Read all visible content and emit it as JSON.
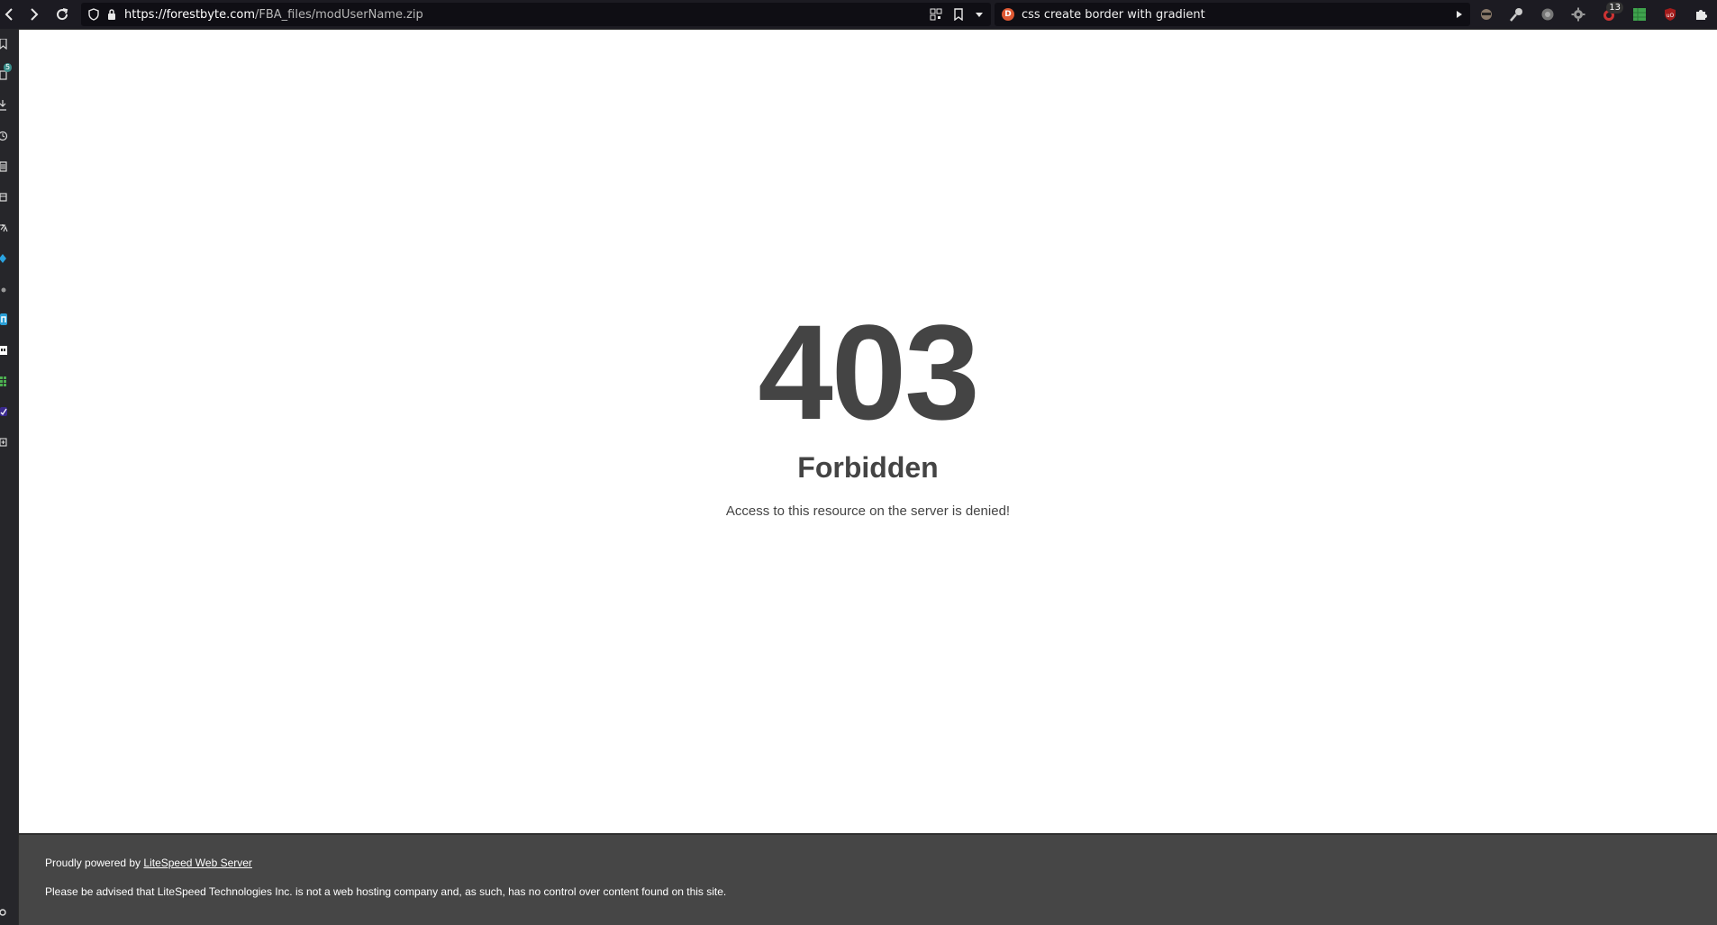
{
  "browser": {
    "address_bar": {
      "url_host": "https://forestbyte.com",
      "url_path": "/FBA_files/modUserName.zip"
    },
    "search_bar": {
      "query": "css create border with gradient"
    },
    "extensions": {
      "badge_count": "13"
    },
    "sidebar": {
      "tabs_badge": "5"
    }
  },
  "page": {
    "error_code": "403",
    "error_title": "Forbidden",
    "error_message": "Access to this resource on the server is denied!",
    "footer": {
      "powered_prefix": "Proudly powered by ",
      "powered_link": "LiteSpeed Web Server",
      "disclaimer": "Please be advised that LiteSpeed Technologies Inc. is not a web hosting company and, as such, has no control over content found on this site."
    }
  },
  "colors": {
    "page_bg": "#ffffff",
    "text": "#444444",
    "footer_bg": "#464646",
    "toolbar_bg": "#1c1b22"
  }
}
